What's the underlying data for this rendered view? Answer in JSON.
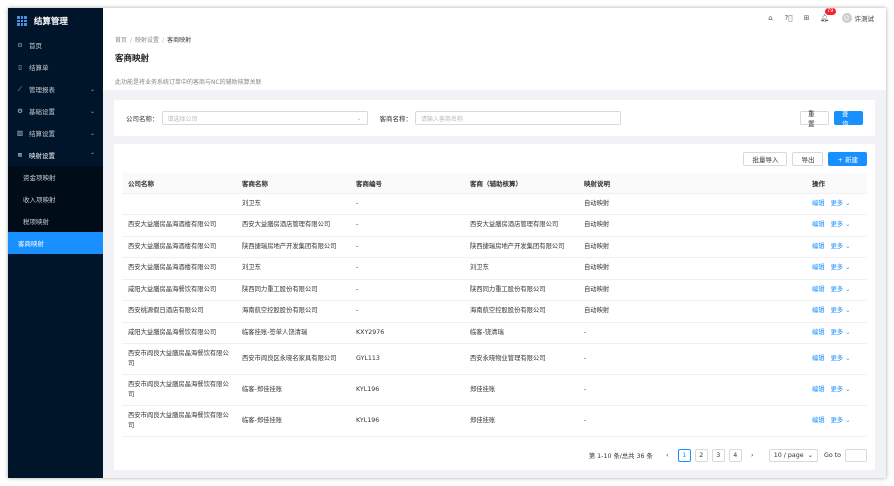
{
  "app": {
    "title": "结算管理"
  },
  "sidebar": {
    "items": [
      {
        "label": "首页",
        "icon": "dashboard-icon",
        "glyph": "⊙"
      },
      {
        "label": "结算单",
        "icon": "document-icon",
        "glyph": "▯"
      },
      {
        "label": "管理报表",
        "icon": "line-chart-icon",
        "glyph": "⟋",
        "chev": "⌄"
      },
      {
        "label": "基础设置",
        "icon": "gear-icon",
        "glyph": "⚙",
        "chev": "⌄"
      },
      {
        "label": "结算设置",
        "icon": "bar-chart-icon",
        "glyph": "▥",
        "chev": "⌄"
      },
      {
        "label": "映射设置",
        "icon": "wifi-icon",
        "glyph": "≋",
        "chev": "⌃"
      }
    ],
    "sub_items": [
      {
        "label": "资金项映射"
      },
      {
        "label": "收入项映射"
      },
      {
        "label": "税项映射"
      },
      {
        "label": "客商映射"
      }
    ]
  },
  "topbar": {
    "notification_count": "79",
    "username": "许测试"
  },
  "breadcrumb": {
    "home": "首页",
    "parent": "映射设置",
    "current": "客商映射"
  },
  "page": {
    "title": "客商映射",
    "description": "此功能是将业务系统订单中的客商与NC的辅助核算关联"
  },
  "filter": {
    "company_label": "公司名称：",
    "company_placeholder": "请选择公司",
    "merchant_label": "客商名称：",
    "merchant_placeholder": "请输入客商名称",
    "reset_label": "重 置",
    "search_label": "查 询"
  },
  "table_actions": {
    "import_label": "批量导入",
    "export_label": "导出",
    "new_label": "+ 新建"
  },
  "table": {
    "columns": [
      "公司名称",
      "客商名称",
      "客商编号",
      "客商（辅助核算）",
      "映射说明",
      "操作"
    ],
    "edit_label": "编辑",
    "more_label": "更多 ⌄",
    "rows": [
      {
        "company": "",
        "merchant": "刘卫东",
        "code": "-",
        "aux": "",
        "desc": "自动映射"
      },
      {
        "company": "西安大益膳房晶海酒楼有限公司",
        "merchant": "西安大益膳房酒店管理有限公司",
        "code": "-",
        "aux": "西安大益膳房酒店管理有限公司",
        "desc": "自动映射"
      },
      {
        "company": "西安大益膳房晶海酒楼有限公司",
        "merchant": "陕西捷瑞房地产开发集团有限公司",
        "code": "-",
        "aux": "陕西捷瑞房地产开发集团有限公司",
        "desc": "自动映射"
      },
      {
        "company": "西安大益膳房晶海酒楼有限公司",
        "merchant": "刘卫东",
        "code": "-",
        "aux": "刘卫东",
        "desc": "自动映射"
      },
      {
        "company": "咸阳大益膳房晶海餐饮有限公司",
        "merchant": "陕西同力重工股份有限公司",
        "code": "-",
        "aux": "陕西同力重工股份有限公司",
        "desc": "自动映射"
      },
      {
        "company": "西安桃源假日酒店有限公司",
        "merchant": "海南航空控股股份有限公司",
        "code": "-",
        "aux": "海南航空控股股份有限公司",
        "desc": "自动映射"
      },
      {
        "company": "咸阳大益膳房晶海餐饮有限公司",
        "merchant": "临客挂账-签单人饶清瑞",
        "code": "KXY2976",
        "aux": "临客-饶清瑞",
        "desc": "-"
      },
      {
        "company": "西安市阎良大益膳房晶海餐饮有限公司",
        "merchant": "西安市阎良区永晓名家具有限公司",
        "code": "GYL113",
        "aux": "西安永晓物业管理有限公司",
        "desc": "-"
      },
      {
        "company": "西安市阎良大益膳房晶海餐饮有限公司",
        "merchant": "临客-郑佳挂账",
        "code": "KYL196",
        "aux": "郑佳挂账",
        "desc": "-"
      },
      {
        "company": "西安市阎良大益膳房晶海餐饮有限公司",
        "merchant": "临客-郑佳挂账",
        "code": "KYL196",
        "aux": "郑佳挂账",
        "desc": "-"
      }
    ]
  },
  "pagination": {
    "summary": "第 1-10 条/总共 36 条",
    "pages": [
      "1",
      "2",
      "3",
      "4"
    ],
    "current_page": "1",
    "page_size": "10 / page",
    "goto_label": "Go to"
  },
  "colors": {
    "primary": "#1890ff",
    "sidebar_bg": "#001529",
    "badge": "#f5222d"
  }
}
